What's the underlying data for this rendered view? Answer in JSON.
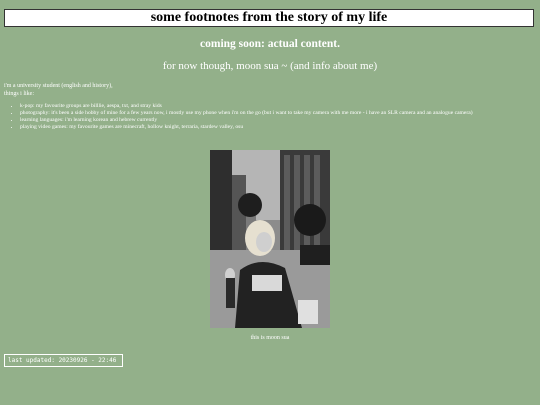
{
  "header": {
    "title": "some footnotes from the story of my life"
  },
  "main": {
    "coming_soon": "coming soon: actual content.",
    "for_now": "for now though, moon sua ~ (and info about me)",
    "intro_line1": "i'm a university student (english and history),",
    "intro_line2": "things i like:",
    "likes": [
      "k-pop: my favourite groups are billlie, aespa, txt, and stray kids",
      "photography: it's been a side hobby of mine for a few years now, i mostly use my phone when i'm on the go (but i want to take my camera with me more - i have an SLR camera and an analogue camera)",
      "learning languages: i'm learning korean and hebrew currently",
      "playing video games: my favourite games are minecraft, hollow knight, terraria, stardew valley, osu"
    ],
    "photo_caption": "this is moon sua"
  },
  "footer": {
    "last_updated": "last updated: 20230926 - 22:46"
  },
  "colors": {
    "background": "#93b08a",
    "text": "#ffffff",
    "title_bg": "#ffffff"
  }
}
